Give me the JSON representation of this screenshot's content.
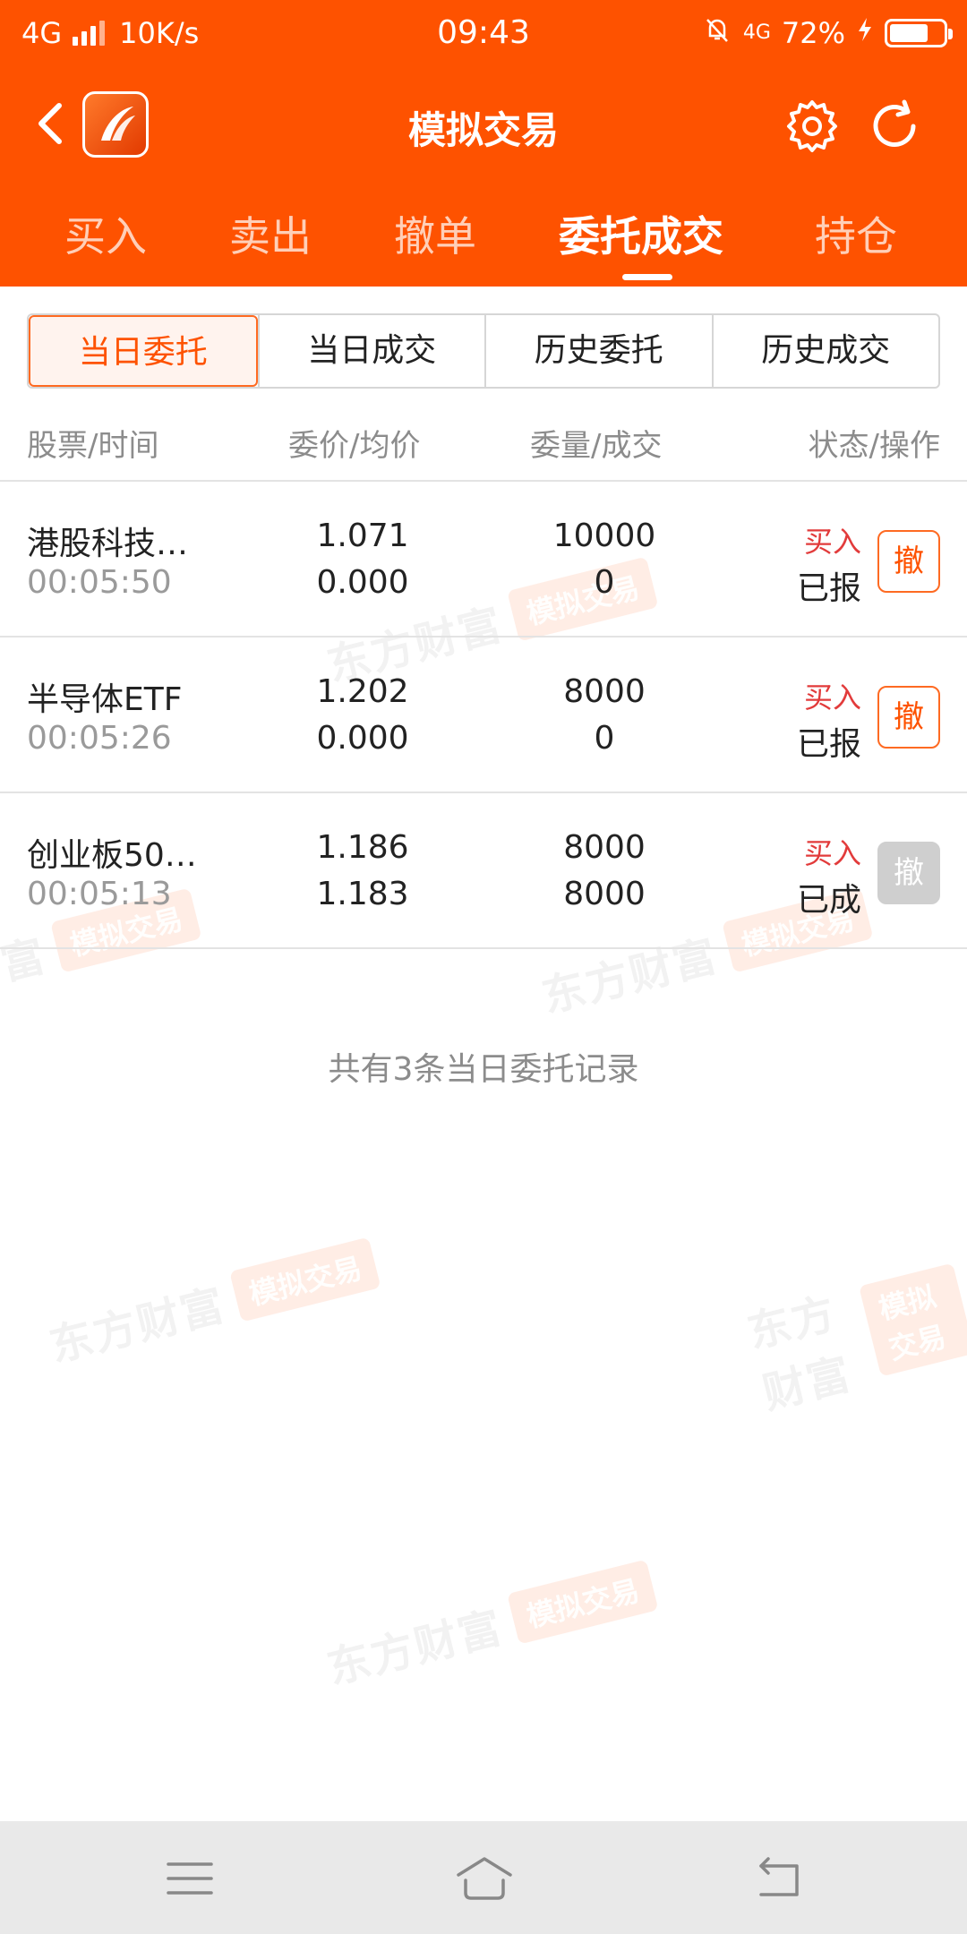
{
  "status_bar": {
    "network": "4G",
    "speed": "10K/s",
    "time": "09:43",
    "network_right": "4G",
    "battery_percent": "72%",
    "battery_level": 0.72
  },
  "nav": {
    "title": "模拟交易"
  },
  "tabs": [
    {
      "label": "买入"
    },
    {
      "label": "卖出"
    },
    {
      "label": "撤单"
    },
    {
      "label": "委托成交"
    },
    {
      "label": "持仓"
    }
  ],
  "segments": [
    {
      "label": "当日委托"
    },
    {
      "label": "当日成交"
    },
    {
      "label": "历史委托"
    },
    {
      "label": "历史成交"
    }
  ],
  "table": {
    "headers": [
      "股票/时间",
      "委价/均价",
      "委量/成交",
      "状态/操作"
    ],
    "rows": [
      {
        "name": "港股科技…",
        "time": "00:05:50",
        "order_price": "1.071",
        "avg_price": "0.000",
        "order_qty": "10000",
        "filled_qty": "0",
        "direction": "买入",
        "status": "已报",
        "action": "撤",
        "action_enabled": true
      },
      {
        "name": "半导体ETF",
        "time": "00:05:26",
        "order_price": "1.202",
        "avg_price": "0.000",
        "order_qty": "8000",
        "filled_qty": "0",
        "direction": "买入",
        "status": "已报",
        "action": "撤",
        "action_enabled": true
      },
      {
        "name": "创业板50…",
        "time": "00:05:13",
        "order_price": "1.186",
        "avg_price": "1.183",
        "order_qty": "8000",
        "filled_qty": "8000",
        "direction": "买入",
        "status": "已成",
        "action": "撤",
        "action_enabled": false
      }
    ]
  },
  "summary": "共有3条当日委托记录",
  "watermark": {
    "brand": "东方财富",
    "tag": "模拟交易"
  },
  "colors": {
    "brand_orange": "#fe5200",
    "buy_red": "#e23b3b",
    "disabled_gray": "#cfcfcf"
  },
  "icons": {
    "back": "chevron-left-icon",
    "logo": "app-logo-icon",
    "settings": "gear-icon",
    "refresh": "refresh-icon",
    "menu": "menu-icon",
    "home": "home-icon",
    "back_nav": "back-icon"
  }
}
